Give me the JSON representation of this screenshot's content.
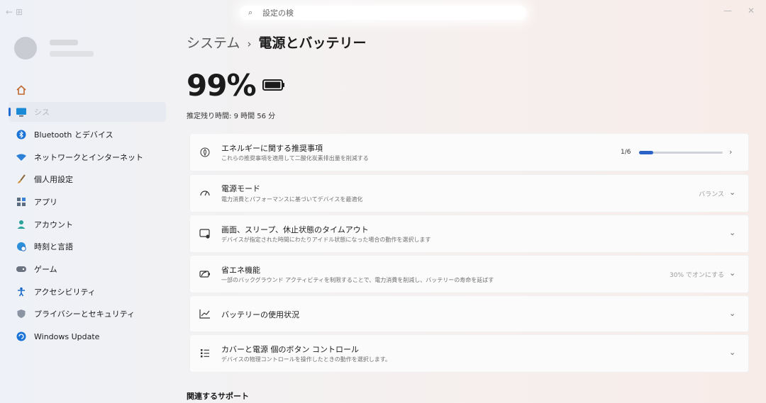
{
  "window": {
    "search_placeholder": "設定の検",
    "controls": [
      "—",
      "✕"
    ]
  },
  "sidebar": {
    "items": [
      {
        "label": "",
        "icon": "home-icon",
        "selected": false
      },
      {
        "label": "シス",
        "icon": "system-icon",
        "selected": true
      },
      {
        "label": "Bluetooth とデバイス",
        "icon": "bluetooth-icon",
        "selected": false
      },
      {
        "label": "ネットワークとインターネット",
        "icon": "wifi-icon",
        "selected": false
      },
      {
        "label": "個人用設定",
        "icon": "brush-icon",
        "selected": false
      },
      {
        "label": "アプリ",
        "icon": "apps-icon",
        "selected": false
      },
      {
        "label": "アカウント",
        "icon": "account-icon",
        "selected": false
      },
      {
        "label": "時刻と言語",
        "icon": "globe-clock-icon",
        "selected": false
      },
      {
        "label": "ゲーム",
        "icon": "gamepad-icon",
        "selected": false
      },
      {
        "label": "アクセシビリティ",
        "icon": "accessibility-icon",
        "selected": false
      },
      {
        "label": "プライバシーとセキュリティ",
        "icon": "shield-icon",
        "selected": false
      },
      {
        "label": "Windows Update",
        "icon": "update-icon",
        "selected": false
      }
    ]
  },
  "header": {
    "breadcrumb_parent": "システム",
    "breadcrumb_separator": "›",
    "breadcrumb_current": "電源とバッテリー"
  },
  "battery": {
    "percent_label": "99%",
    "level": 0.99,
    "remaining_prefix": "推定残り時間:",
    "remaining_value": "9 時間 56 分"
  },
  "cards": [
    {
      "id": "energy-recommendations",
      "icon": "leaf-icon",
      "title": "エネルギーに関する推奨事項",
      "desc": "これらの推奨事項を適用して二酸化炭素排出量を削減する",
      "progress_label": "1/6",
      "progress": 0.1667,
      "chevron": "›"
    },
    {
      "id": "power-mode",
      "icon": "power-mode-icon",
      "title": "電源モード",
      "desc": "電力消費とパフォーマンスに基づいてデバイスを最適化",
      "value": "バランス",
      "chevron": "⌄"
    },
    {
      "id": "screen-sleep-timeout",
      "icon": "screen-sleep-icon",
      "title": "画面、スリープ、休止状態のタイムアウト",
      "desc": "デバイスが指定された時間にわたりアイドル状態になった場合の動作を選択します",
      "chevron": "⌄"
    },
    {
      "id": "battery-saver",
      "icon": "battery-saver-icon",
      "title": "省エネ機能",
      "desc": "一部のバックグラウンド アクティビティを制限することで、電力消費を削減し、バッテリーの寿命を延ばす",
      "value": "30% でオンにする",
      "chevron": "⌄"
    },
    {
      "id": "battery-usage",
      "icon": "chart-icon",
      "title": "バッテリーの使用状況",
      "chevron": "⌄"
    },
    {
      "id": "lid-power-buttons",
      "icon": "list-icon",
      "title": "カバーと電源 個のボタン コントロール",
      "desc": "デバイスの物理コントロールを操作したときの動作を選択します。",
      "chevron": "⌄"
    }
  ],
  "related": {
    "heading": "関連するサポート"
  },
  "colors": {
    "accent": "#2a62c6",
    "selected_indicator": "#1f6ad3"
  }
}
